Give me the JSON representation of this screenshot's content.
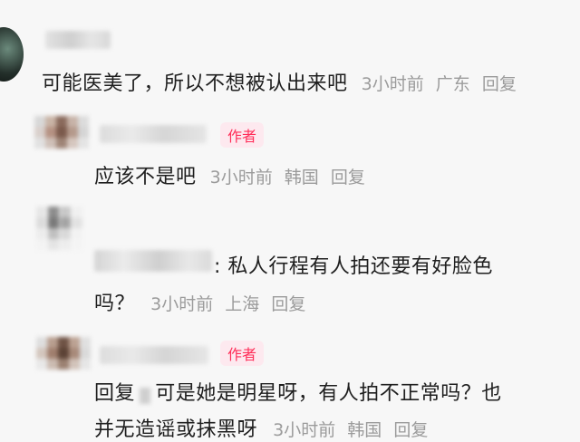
{
  "comments": [
    {
      "text": "可能医美了，所以不想被认出来吧",
      "time": "3小时前",
      "location": "广东",
      "reply_label": "回复"
    },
    {
      "author_tag": "作者",
      "text": "应该不是吧",
      "time": "3小时前",
      "location": "韩国",
      "reply_label": "回复"
    },
    {
      "colon_text": ": 私人行程有人拍还要有好脸色",
      "text_line2": "吗？",
      "time": "3小时前",
      "location": "上海",
      "reply_label": "回复"
    },
    {
      "author_tag": "作者",
      "reply_prefix": "回复",
      "text_line1": "可是她是明星呀，有人拍不正常吗？也",
      "text_line2": "并无造谣或抹黑呀",
      "time": "3小时前",
      "location": "韩国",
      "reply_label": "回复"
    }
  ],
  "colors": {
    "background": "#f7f7f7",
    "meta_text": "#9b9b9b",
    "author_tag_text": "#ff2e59",
    "author_tag_bg": "#fde9ef"
  }
}
